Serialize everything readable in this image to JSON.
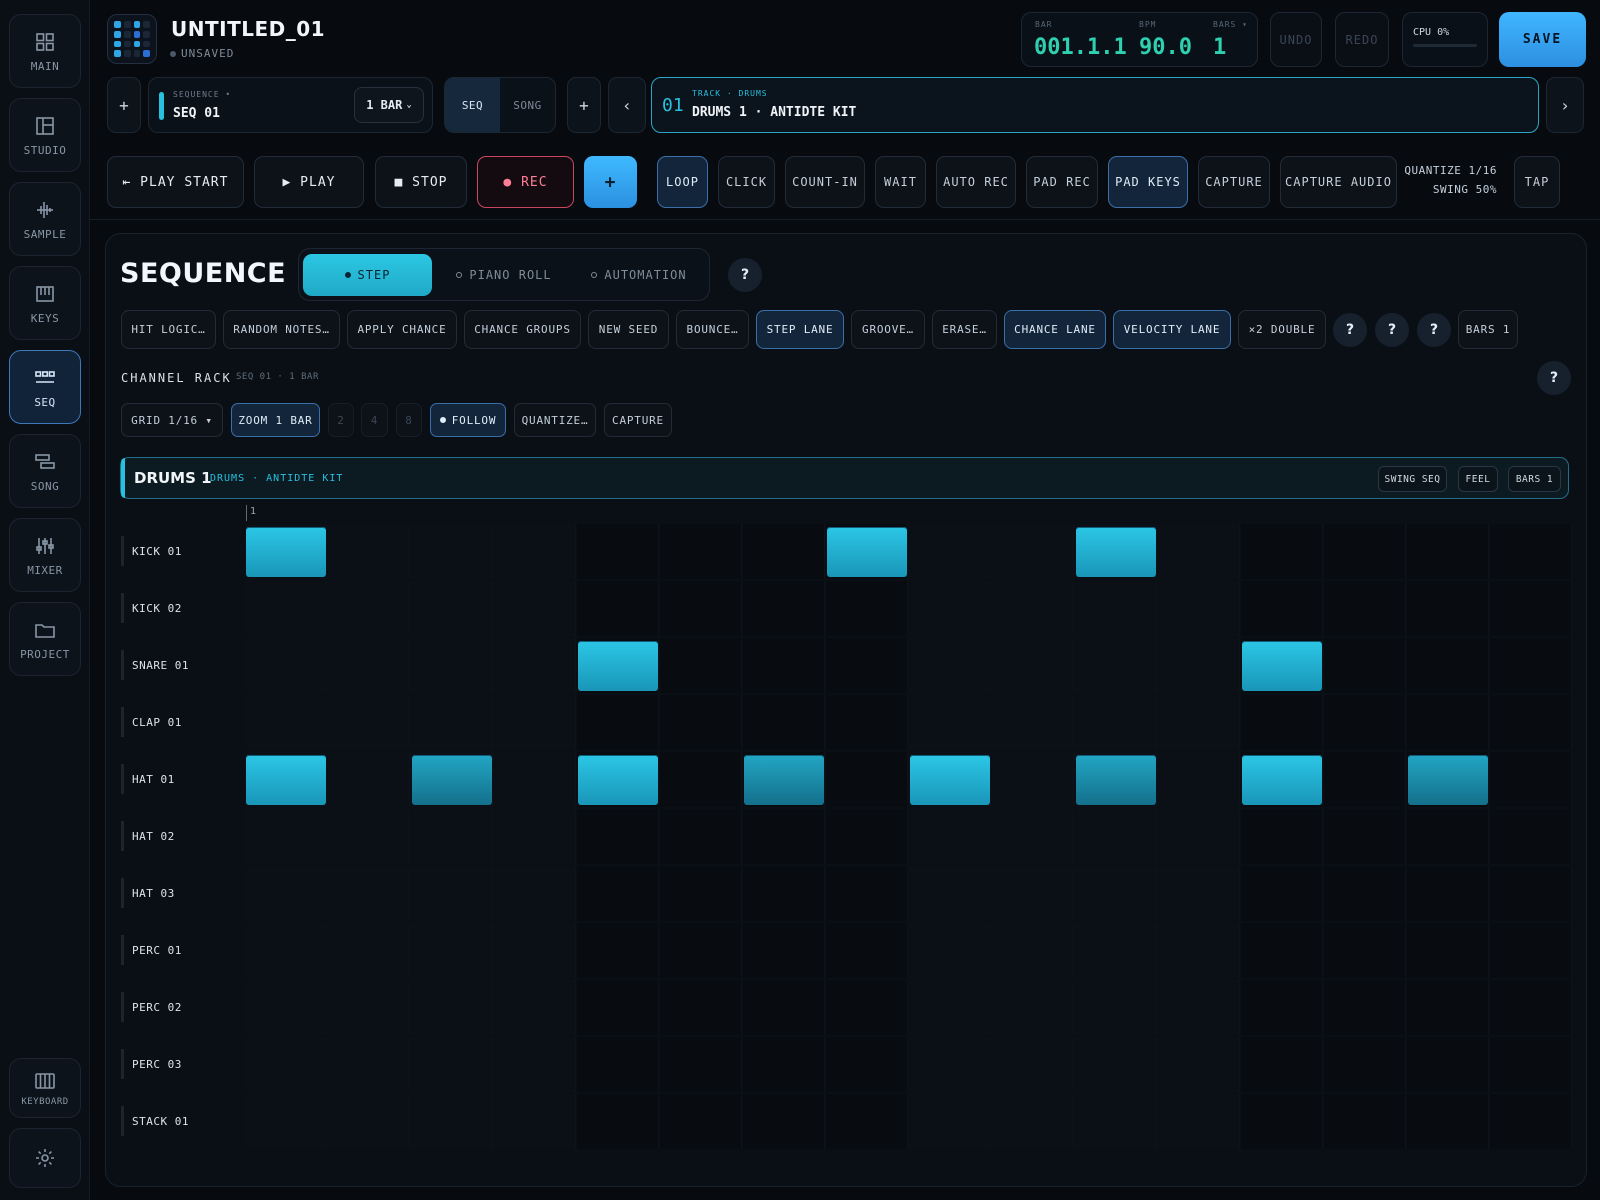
{
  "sidebar": {
    "items": [
      {
        "label": "MAIN",
        "icon": "grid-icon"
      },
      {
        "label": "STUDIO",
        "icon": "layout-icon"
      },
      {
        "label": "SAMPLE",
        "icon": "waveform-icon"
      },
      {
        "label": "KEYS",
        "icon": "piano-icon"
      },
      {
        "label": "SEQ",
        "icon": "sequencer-icon",
        "active": true
      },
      {
        "label": "SONG",
        "icon": "song-icon"
      },
      {
        "label": "MIXER",
        "icon": "mixer-icon"
      },
      {
        "label": "PROJECT",
        "icon": "folder-icon"
      }
    ],
    "keyboard_label": "KEYBOARD",
    "settings_icon": "gear-icon"
  },
  "header": {
    "title": "UNTITLED_01",
    "status": "UNSAVED",
    "bar_label": "BAR",
    "bar_value": "001.1.1",
    "bpm_label": "BPM",
    "bpm_value": "90.0",
    "bars_label": "BARS ▾",
    "bars_value": "1",
    "undo": "UNDO",
    "redo": "REDO",
    "cpu": "CPU 0%",
    "cpu_load": 0,
    "save": "SAVE"
  },
  "sequence_bar": {
    "add": "+",
    "seq_label": "SEQUENCE •",
    "seq_name": "SEQ 01",
    "length": "1 BAR",
    "mode_seq": "SEQ",
    "mode_song": "SONG",
    "add2": "+",
    "prev": "‹",
    "next": "›",
    "track_num": "01",
    "track_label": "TRACK · DRUMS",
    "track_name": "DRUMS 1 · ANTIDTE KIT"
  },
  "transport": {
    "play_start": "⇤ PLAY START",
    "play": "▶ PLAY",
    "stop": "■ STOP",
    "rec": "● REC",
    "add": "+",
    "loop": "LOOP",
    "click": "CLICK",
    "count_in": "COUNT-IN",
    "wait": "WAIT",
    "auto_rec": "AUTO REC",
    "pad_rec": "PAD REC",
    "pad_keys": "PAD KEYS",
    "capture": "CAPTURE",
    "capture_audio": "CAPTURE AUDIO",
    "quantize": "QUANTIZE 1/16",
    "swing": "SWING 50%",
    "tap": "TAP"
  },
  "sequence_panel": {
    "title": "SEQUENCE",
    "tabs": [
      "STEP",
      "PIANO ROLL",
      "AUTOMATION"
    ],
    "help": "?",
    "tools": [
      "HIT LOGIC…",
      "RANDOM NOTES…",
      "APPLY CHANCE",
      "CHANCE GROUPS",
      "NEW SEED",
      "BOUNCE…",
      "STEP LANE",
      "GROOVE…",
      "ERASE…",
      "CHANCE LANE",
      "VELOCITY LANE",
      "×2 DOUBLE"
    ],
    "tool_help": [
      "?",
      "?",
      "?"
    ],
    "bars": "BARS 1"
  },
  "channel_rack": {
    "title": "CHANNEL RACK",
    "subtitle": "SEQ 01 · 1 BAR",
    "help": "?",
    "grid": "GRID 1/16 ▾",
    "zoom": "ZOOM 1 BAR",
    "zoom2": "2",
    "zoom4": "4",
    "zoom8": "8",
    "follow": "FOLLOW",
    "quantize": "QUANTIZE…",
    "capture": "CAPTURE"
  },
  "track": {
    "name": "DRUMS 1",
    "sub": "DRUMS · ANTIDTE KIT",
    "swing_seq": "SWING SEQ",
    "feel": "FEEL",
    "bars": "BARS 1",
    "bar_number": "1"
  },
  "rows": [
    {
      "name": "KICK 01",
      "steps": [
        0,
        7,
        10
      ]
    },
    {
      "name": "KICK 02",
      "steps": []
    },
    {
      "name": "SNARE 01",
      "steps": [
        4,
        12
      ]
    },
    {
      "name": "CLAP 01",
      "steps": []
    },
    {
      "name": "HAT 01",
      "steps": [
        0,
        2,
        4,
        6,
        8,
        10,
        12,
        14
      ]
    },
    {
      "name": "HAT 02",
      "steps": []
    },
    {
      "name": "HAT 03",
      "steps": []
    },
    {
      "name": "PERC 01",
      "steps": []
    },
    {
      "name": "PERC 02",
      "steps": []
    },
    {
      "name": "PERC 03",
      "steps": []
    },
    {
      "name": "STACK 01",
      "steps": []
    }
  ],
  "colors": {
    "accent": "#27c0de",
    "save": "#40b6ff",
    "rec": "#ff7d95",
    "readout": "#2ed0b0"
  }
}
